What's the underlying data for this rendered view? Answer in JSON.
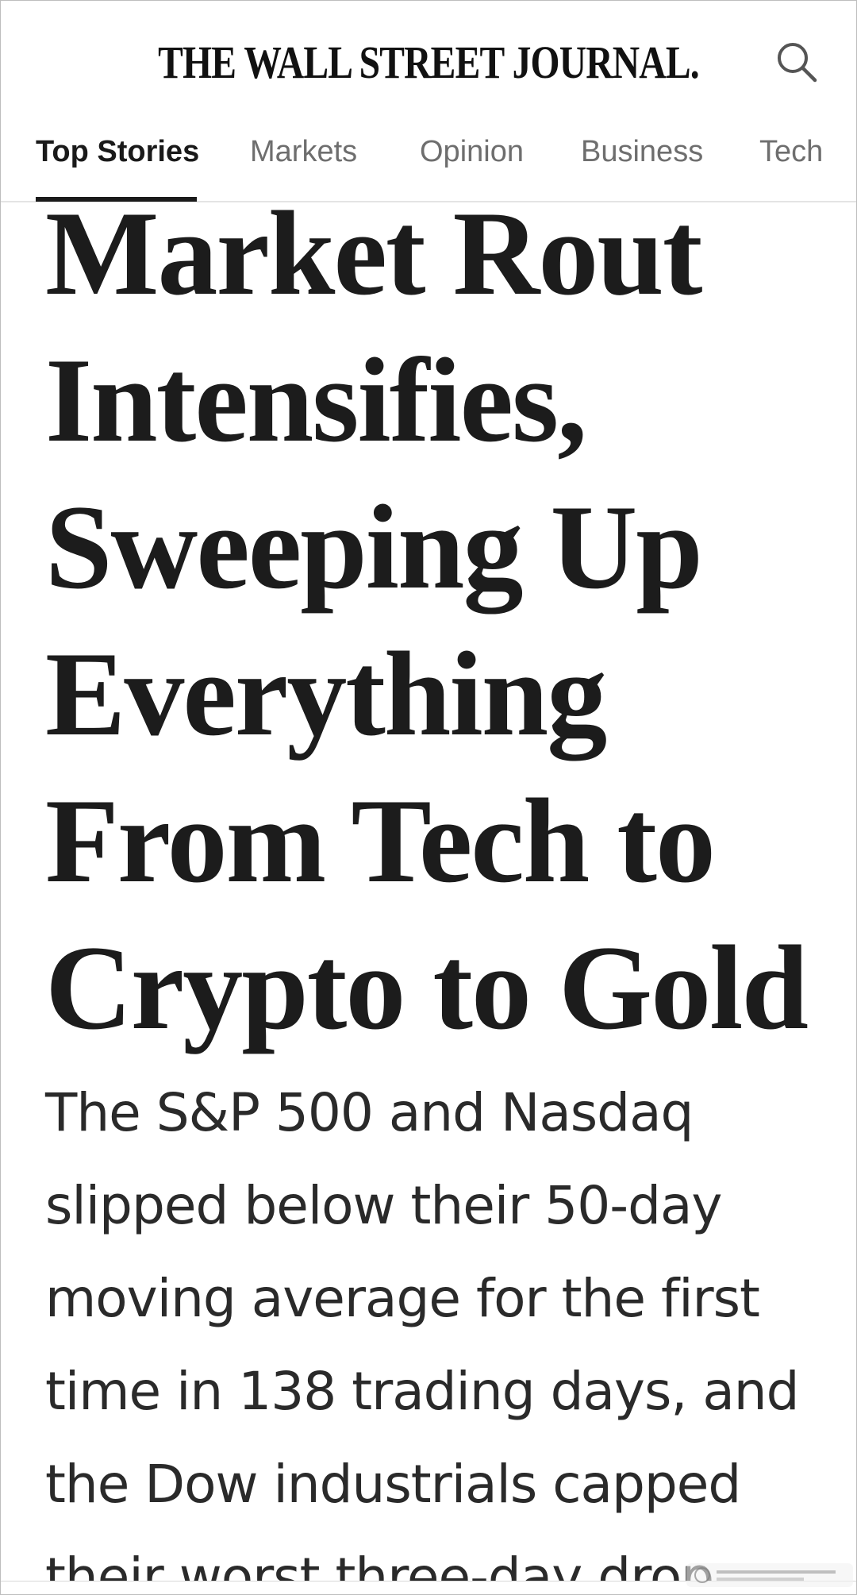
{
  "header": {
    "logo_text": "THE WALL STREET JOURNAL.",
    "search_icon": "search-icon"
  },
  "nav": {
    "tabs": [
      {
        "label": "Top Stories",
        "active": true
      },
      {
        "label": "Markets",
        "active": false
      },
      {
        "label": "Opinion",
        "active": false
      },
      {
        "label": "Business",
        "active": false
      },
      {
        "label": "Tech",
        "active": false
      }
    ]
  },
  "article": {
    "headline": "Market Rout Intensifies, Sweeping Up Everything From Tech to Crypto to Gold",
    "dek": "The S&P 500 and Nasdaq slipped below their 50-day moving average for the first time in 138 trading days, and the Dow industrials capped their worst three-day drop"
  },
  "colors": {
    "text": "#1c1c1c",
    "tab_inactive": "#6e6e6e",
    "divider": "#e4e4e4"
  }
}
